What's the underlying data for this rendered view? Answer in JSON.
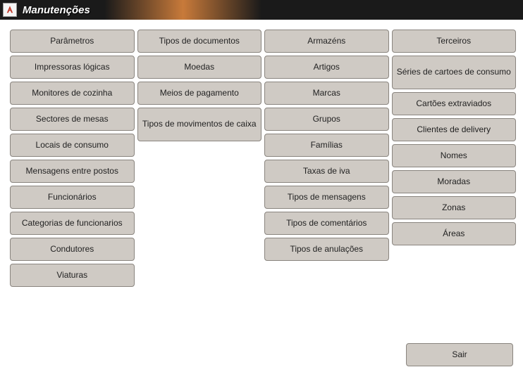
{
  "header": {
    "title": "Manutenções"
  },
  "columns": {
    "col1": [
      "Parâmetros",
      "Impressoras lógicas",
      "Monitores de cozinha",
      "Sectores de mesas",
      "Locais de consumo",
      "Mensagens entre postos",
      "Funcionários",
      "Categorias de funcionarios",
      "Condutores",
      "Viaturas"
    ],
    "col2": [
      "Tipos de documentos",
      "Moedas",
      "Meios de pagamento",
      "Tipos de movimentos de caixa"
    ],
    "col3": [
      "Armazéns",
      "Artigos",
      "Marcas",
      "Grupos",
      "Famílias",
      "Taxas de iva",
      "Tipos de mensagens",
      "Tipos de comentários",
      "Tipos de anulações"
    ],
    "col4": [
      "Terceiros",
      "Séries de cartoes de consumo",
      "Cartões extraviados",
      "Clientes de delivery",
      "Nomes",
      "Moradas",
      "Zonas",
      "Áreas"
    ]
  },
  "exit": "Sair"
}
